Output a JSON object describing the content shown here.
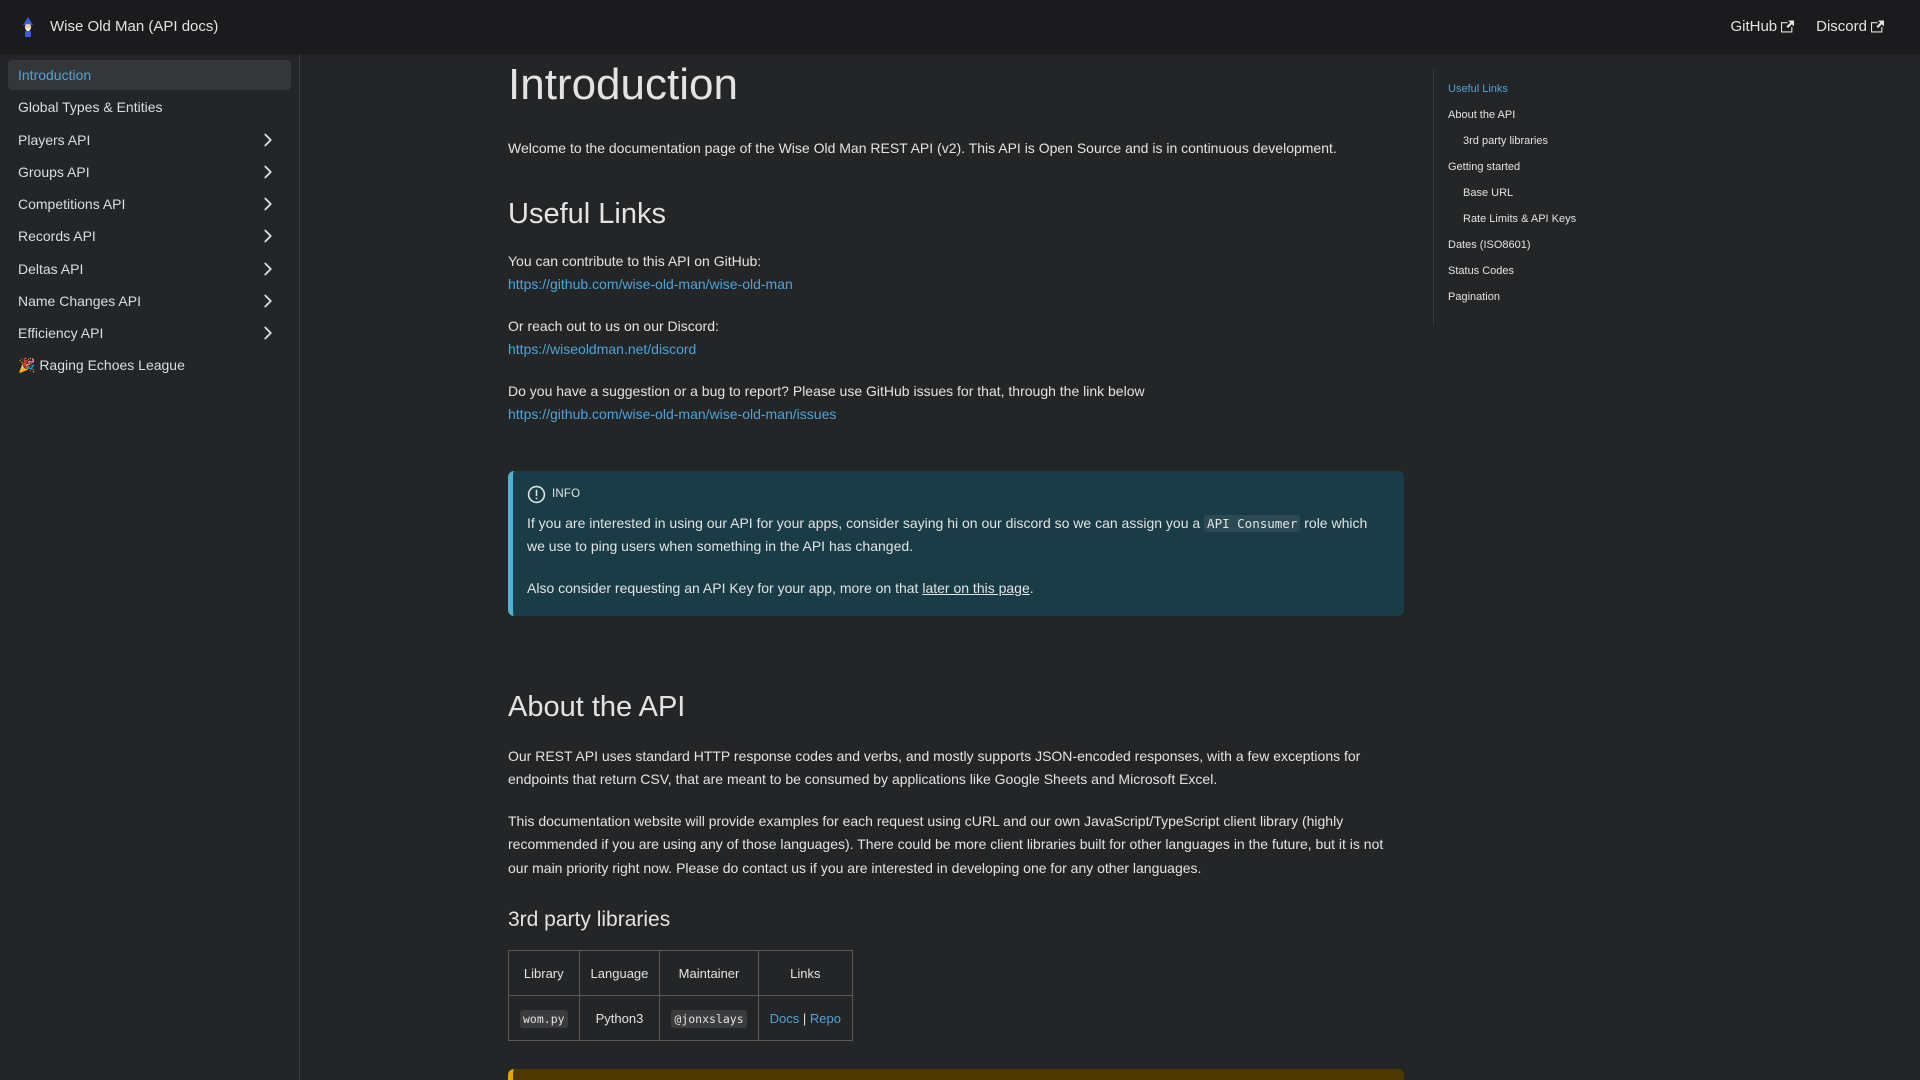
{
  "navbar": {
    "title": "Wise Old Man (API docs)",
    "links": [
      {
        "label": "GitHub"
      },
      {
        "label": "Discord"
      }
    ]
  },
  "sidebar": {
    "items": [
      {
        "label": "Introduction",
        "active": true,
        "expandable": false
      },
      {
        "label": "Global Types & Entities",
        "expandable": false
      },
      {
        "label": "Players API",
        "expandable": true
      },
      {
        "label": "Groups API",
        "expandable": true
      },
      {
        "label": "Competitions API",
        "expandable": true
      },
      {
        "label": "Records API",
        "expandable": true
      },
      {
        "label": "Deltas API",
        "expandable": true
      },
      {
        "label": "Name Changes API",
        "expandable": true
      },
      {
        "label": "Efficiency API",
        "expandable": true
      },
      {
        "label": "🎉 Raging Echoes League",
        "expandable": false
      }
    ]
  },
  "main": {
    "title": "Introduction",
    "intro": "Welcome to the documentation page of the Wise Old Man REST API (v2). This API is Open Source and is in continuous development.",
    "useful_links": {
      "heading": "Useful Links",
      "github_text": "You can contribute to this API on GitHub:",
      "github_url": "https://github.com/wise-old-man/wise-old-man",
      "discord_text": "Or reach out to us on our Discord:",
      "discord_url": "https://wiseoldman.net/discord",
      "issues_text": "Do you have a suggestion or a bug to report? Please use GitHub issues for that, through the link below",
      "issues_url": "https://github.com/wise-old-man/wise-old-man/issues"
    },
    "info": {
      "label": "INFO",
      "p1_before": "If you are interested in using our API for your apps, consider saying hi on our discord so we can assign you a ",
      "p1_code": "API Consumer",
      "p1_after": " role which we use to ping users when something in the API has changed.",
      "p2_before": "Also consider requesting an API Key for your app, more on that ",
      "p2_link": "later on this page",
      "p2_after": "."
    },
    "about": {
      "heading": "About the API",
      "p1": "Our REST API uses standard HTTP response codes and verbs, and mostly supports JSON-encoded responses, with a few exceptions for endpoints that return CSV, that are meant to be consumed by applications like Google Sheets and Microsoft Excel.",
      "p2": "This documentation website will provide examples for each request using cURL and our own JavaScript/TypeScript client library (highly recommended if you are using any of those languages). There could be more client libraries built for other languages in the future, but it is not our main priority right now. Please do contact us if you are interested in developing one for any other languages."
    },
    "libraries": {
      "heading": "3rd party libraries",
      "columns": [
        "Library",
        "Language",
        "Maintainer",
        "Links"
      ],
      "rows": [
        {
          "library": "wom.py",
          "language": "Python3",
          "maintainer": "@jonxslays",
          "docs": "Docs",
          "sep": "|",
          "repo": "Repo"
        }
      ]
    }
  },
  "toc": {
    "items": [
      {
        "label": "Useful Links",
        "active": true,
        "level": 1
      },
      {
        "label": "About the API",
        "level": 1
      },
      {
        "label": "3rd party libraries",
        "level": 2
      },
      {
        "label": "Getting started",
        "level": 1
      },
      {
        "label": "Base URL",
        "level": 2
      },
      {
        "label": "Rate Limits & API Keys",
        "level": 2
      },
      {
        "label": "Dates (ISO8601)",
        "level": 1
      },
      {
        "label": "Status Codes",
        "level": 1
      },
      {
        "label": "Pagination",
        "level": 1
      }
    ]
  },
  "colors": {
    "background": "#242526",
    "navbar": "#1b1b1d",
    "link": "#4fa3d9",
    "info_bg": "#193c47",
    "info_border": "#4cb3d4",
    "warning_border": "#e6a700"
  }
}
